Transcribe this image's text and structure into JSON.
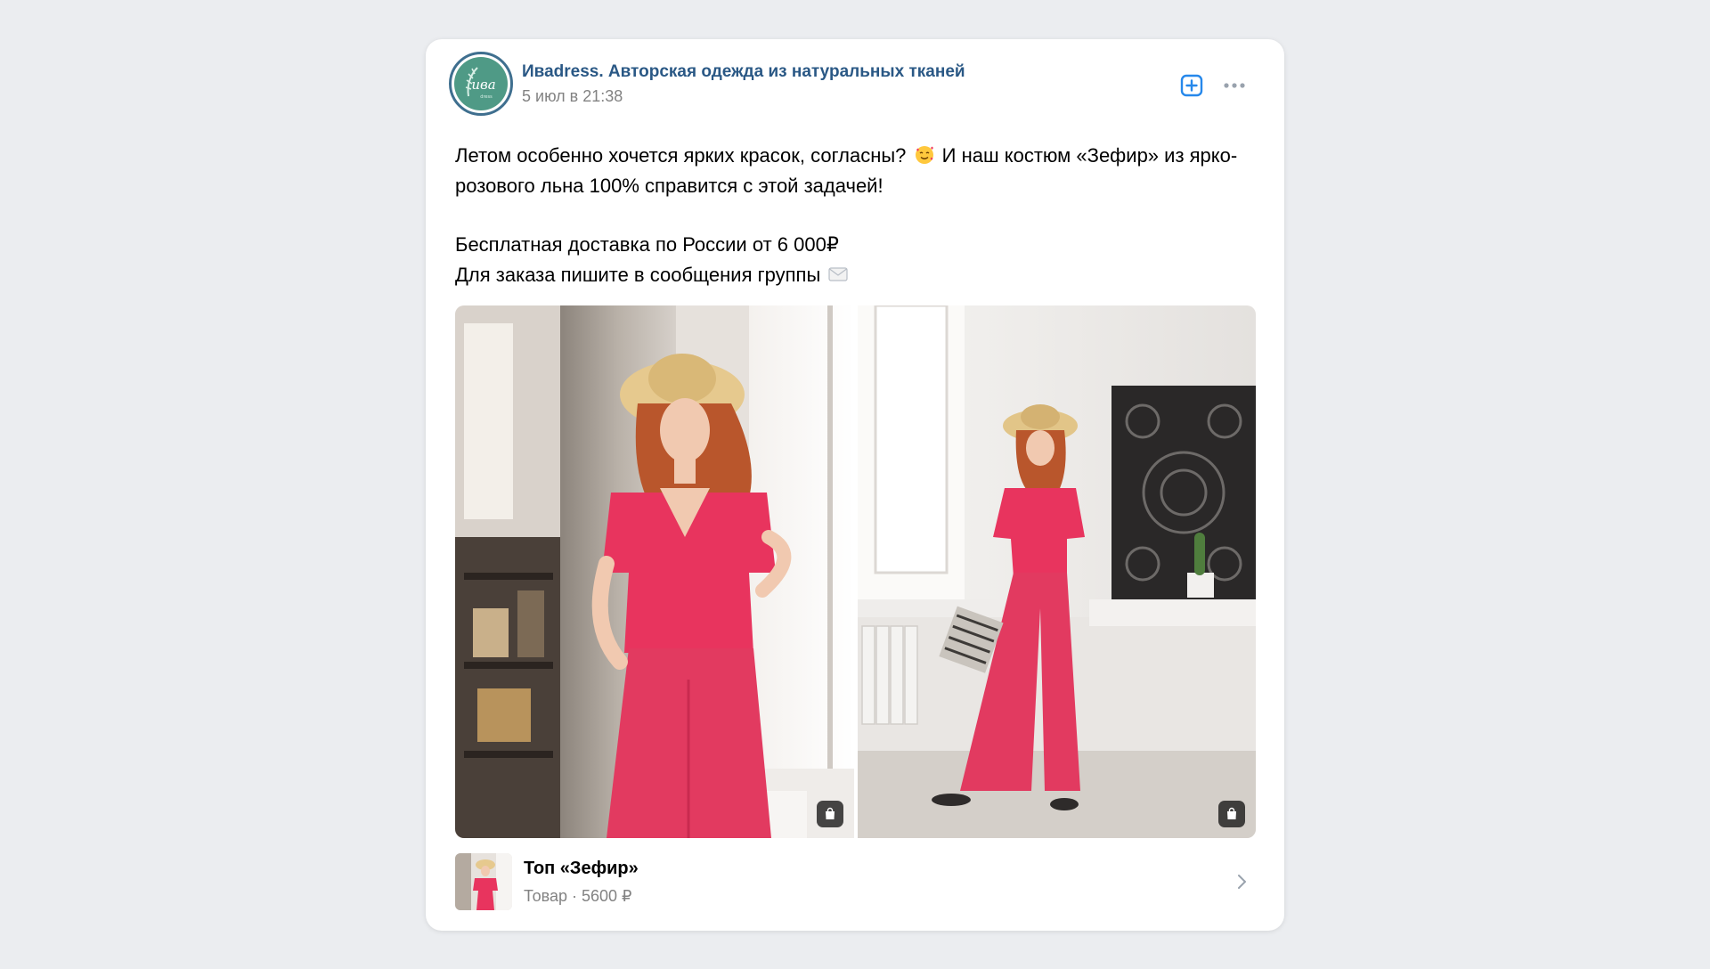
{
  "post": {
    "group_name": "Иваdress. Авторская одежда из натуральных тканей",
    "date": "5 июл в 21:38",
    "avatar_text": "ива",
    "text_line1_a": "Летом особенно хочется ярких красок, согласны?",
    "text_line1_b": "И наш костюм «Зефир» из ярко-розового льна 100% справится с этой задачей!",
    "text_line2": "Бесплатная доставка по России от 6 000₽",
    "text_line3": "Для заказа пишите в сообщения группы",
    "emoji_1": "smiling-face-with-hearts-icon",
    "emoji_2": "envelope-icon"
  },
  "header_actions": {
    "add_icon": "plus-square-icon",
    "more_icon": "more-horizontal-icon"
  },
  "photos": [
    {
      "badge_icon": "shopping-bag-icon"
    },
    {
      "badge_icon": "shopping-bag-icon"
    }
  ],
  "product": {
    "title": "Топ «Зефир»",
    "subtitle": "Товар · 5600 ₽",
    "chevron_icon": "chevron-right-icon"
  },
  "colors": {
    "page_bg": "#ebedf0",
    "link": "#2a5885",
    "secondary_text": "#828282",
    "accent_blue": "#2688eb",
    "suit_pink": "#e8345e"
  }
}
